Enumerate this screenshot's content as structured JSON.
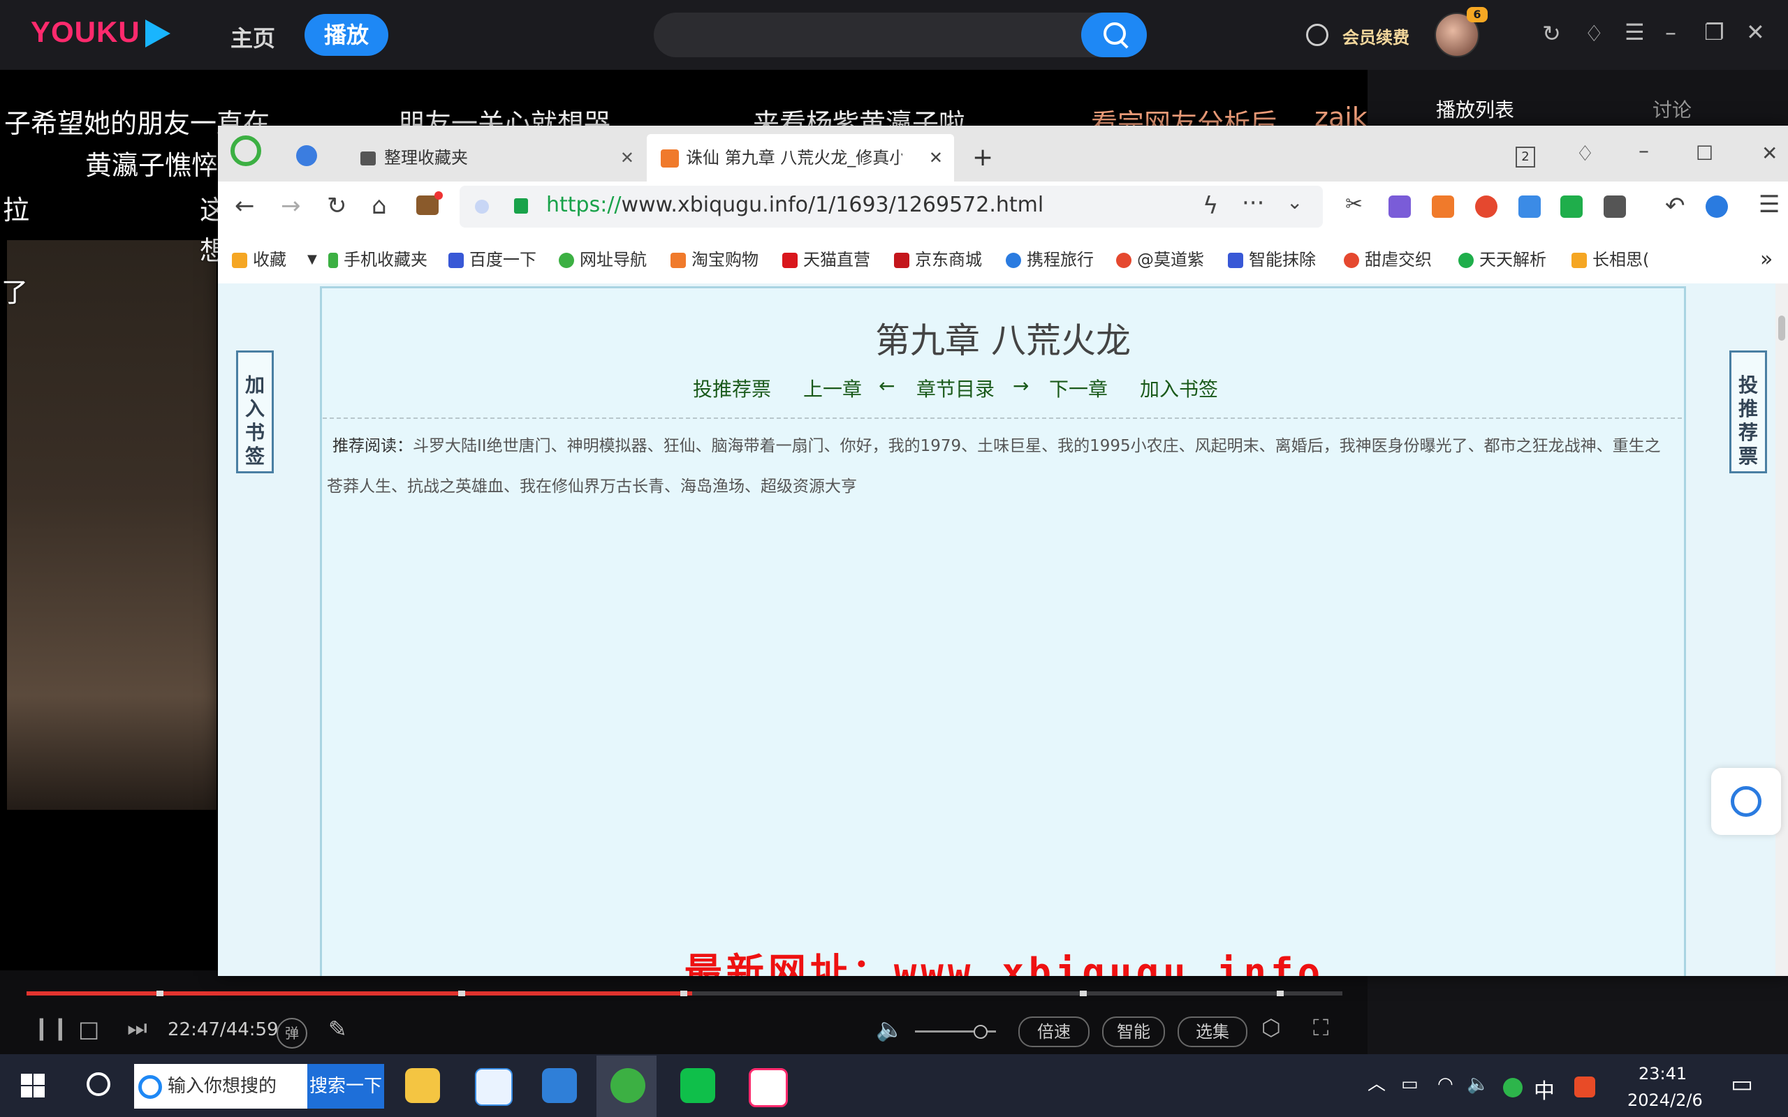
{
  "youku": {
    "logo": "YOUKU",
    "nav_home": "主页",
    "nav_play": "播放",
    "search_placeholder": "",
    "vip_label": "会员续费",
    "avatar_badge": "6",
    "playlist_tab": "播放列表",
    "discuss_tab": "讨论",
    "danmu": [
      "子希望她的朋友一直在",
      "朋友一关心就想哭",
      "来看杨紫黄瀛子啦",
      "看完网友分析后",
      "zaik",
      "黄瀛子憔悴",
      "拉",
      "这",
      "想",
      "了"
    ],
    "time": "22:47/44:59",
    "progress_fraction": 0.506,
    "controls": {
      "danmu_label": "弹",
      "speed": "倍速",
      "smart": "智能",
      "episodes": "选集"
    }
  },
  "browser": {
    "tab1_title": "整理收藏夹",
    "tab2_title": "诛仙 第九章 八荒火龙_修真小说",
    "tab_count": "2",
    "url_scheme": "https://",
    "url_rest": "www.xbiqugu.info/1/1693/1269572.html",
    "bookmarks": [
      "收藏",
      "手机收藏夹",
      "百度一下",
      "网址导航",
      "淘宝购物",
      "天猫直营",
      "京东商城",
      "携程旅行",
      "@莫道紫",
      "智能抹除",
      "甜虐交织",
      "天天解析",
      "长相思("
    ],
    "more_bookmarks": "»"
  },
  "page": {
    "chapter_title": "第九章 八荒火龙",
    "nav": {
      "vote": "投推荐票",
      "prev": "上一章",
      "arrow_left": "←",
      "toc": "章节目录",
      "arrow_right": "→",
      "next": "下一章",
      "bookmark": "加入书签"
    },
    "rec_label": "推荐阅读：",
    "rec_text": "斗罗大陆II绝世唐门、神明模拟器、狂仙、脑海带着一扇门、你好，我的1979、土味巨星、我的1995小农庄、风起明末、离婚后，我神医身份曝光了、都市之狂龙战神、重生之苍莽人生、抗战之英雄血、我在修仙界万古长青、海岛渔场、超级资源大亨",
    "side_left": "加入书签",
    "side_right": "投推荐票",
    "new_url": "最新网址：www.xbiqugu.info"
  },
  "taskbar": {
    "search_placeholder": "输入你想搜的",
    "search_button": "搜索一下",
    "ime": "中",
    "time": "23:41",
    "date": "2024/2/6"
  },
  "colors": {
    "youku_blue": "#1e88f5",
    "youku_red": "#e3342f",
    "page_bg": "#e6f7fc",
    "url_green": "#19a24a",
    "link_green": "#1a5a1a",
    "warning_red": "#e11"
  }
}
